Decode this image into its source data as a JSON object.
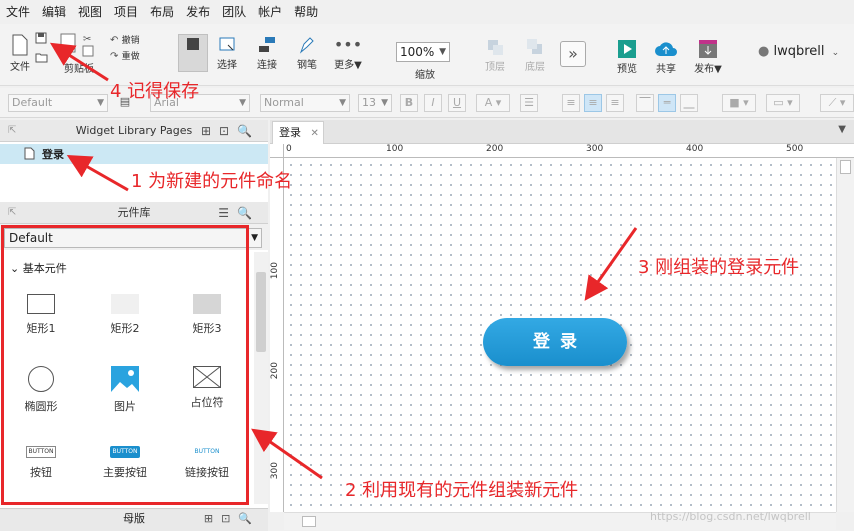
{
  "menu": [
    "文件",
    "编辑",
    "视图",
    "项目",
    "布局",
    "发布",
    "团队",
    "帐户",
    "帮助"
  ],
  "toolbar": {
    "file": "文件",
    "clipboard": "剪贴板",
    "undo": "撤销",
    "redo": "重做",
    "select": "选择",
    "connect": "连接",
    "pen": "钢笔",
    "more": "更多▼",
    "zoom_value": "100%",
    "zoom": "缩放",
    "top_layer": "顶层",
    "bottom_layer": "底层",
    "preview": "预览",
    "share": "共享",
    "publish": "发布▼",
    "user": "lwqbrell"
  },
  "format": {
    "style": "Default",
    "font": "Arial",
    "weight": "Normal",
    "size": "13"
  },
  "pages_panel": {
    "title": "Widget Library Pages",
    "page_name": "登录"
  },
  "library_panel": {
    "title": "元件库",
    "selected": "Default",
    "section": "基本元件",
    "widgets": [
      "矩形1",
      "矩形2",
      "矩形3",
      "椭圆形",
      "图片",
      "占位符",
      "按钮",
      "主要按钮",
      "链接按钮"
    ],
    "button_text": "BUTTON"
  },
  "masters_panel": {
    "title": "母版"
  },
  "canvas": {
    "tab": "登录",
    "ruler_x": [
      "0",
      "100",
      "200",
      "300",
      "400",
      "500"
    ],
    "ruler_y": [
      "100",
      "200",
      "300"
    ],
    "login_button": "登录"
  },
  "annotations": {
    "a1": "1 为新建的元件命名",
    "a2": "2 利用现有的元件组装新元件",
    "a3": "3 刚组装的登录元件",
    "a4": "4 记得保存"
  },
  "watermark": "https://blog.csdn.net/lwqbrell",
  "colors": {
    "accent": "#1a8fcd",
    "annotation": "#e8272a",
    "selection": "#cce8f4"
  }
}
